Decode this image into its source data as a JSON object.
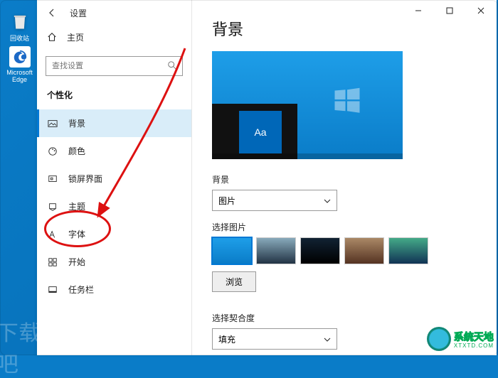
{
  "desktop": {
    "recycle_label": "回收站",
    "edge_label": "Microsoft Edge"
  },
  "titlebar": {
    "app_name": "设置"
  },
  "sidebar": {
    "home_label": "主页",
    "search_placeholder": "查找设置",
    "section_title": "个性化",
    "items": [
      {
        "label": "背景"
      },
      {
        "label": "颜色"
      },
      {
        "label": "锁屏界面"
      },
      {
        "label": "主题"
      },
      {
        "label": "字体"
      },
      {
        "label": "开始"
      },
      {
        "label": "任务栏"
      }
    ]
  },
  "main": {
    "title": "背景",
    "bg_section_label": "背景",
    "bg_dropdown_value": "图片",
    "choose_pic_label": "选择图片",
    "browse_label": "浏览",
    "fit_label": "选择契合度",
    "fit_dropdown_value": "填充",
    "preview_sample_text": "Aa"
  },
  "watermark": {
    "left_text": "下载吧",
    "brand_text": "系统天地",
    "brand_sub": "XTXTD.COM"
  }
}
